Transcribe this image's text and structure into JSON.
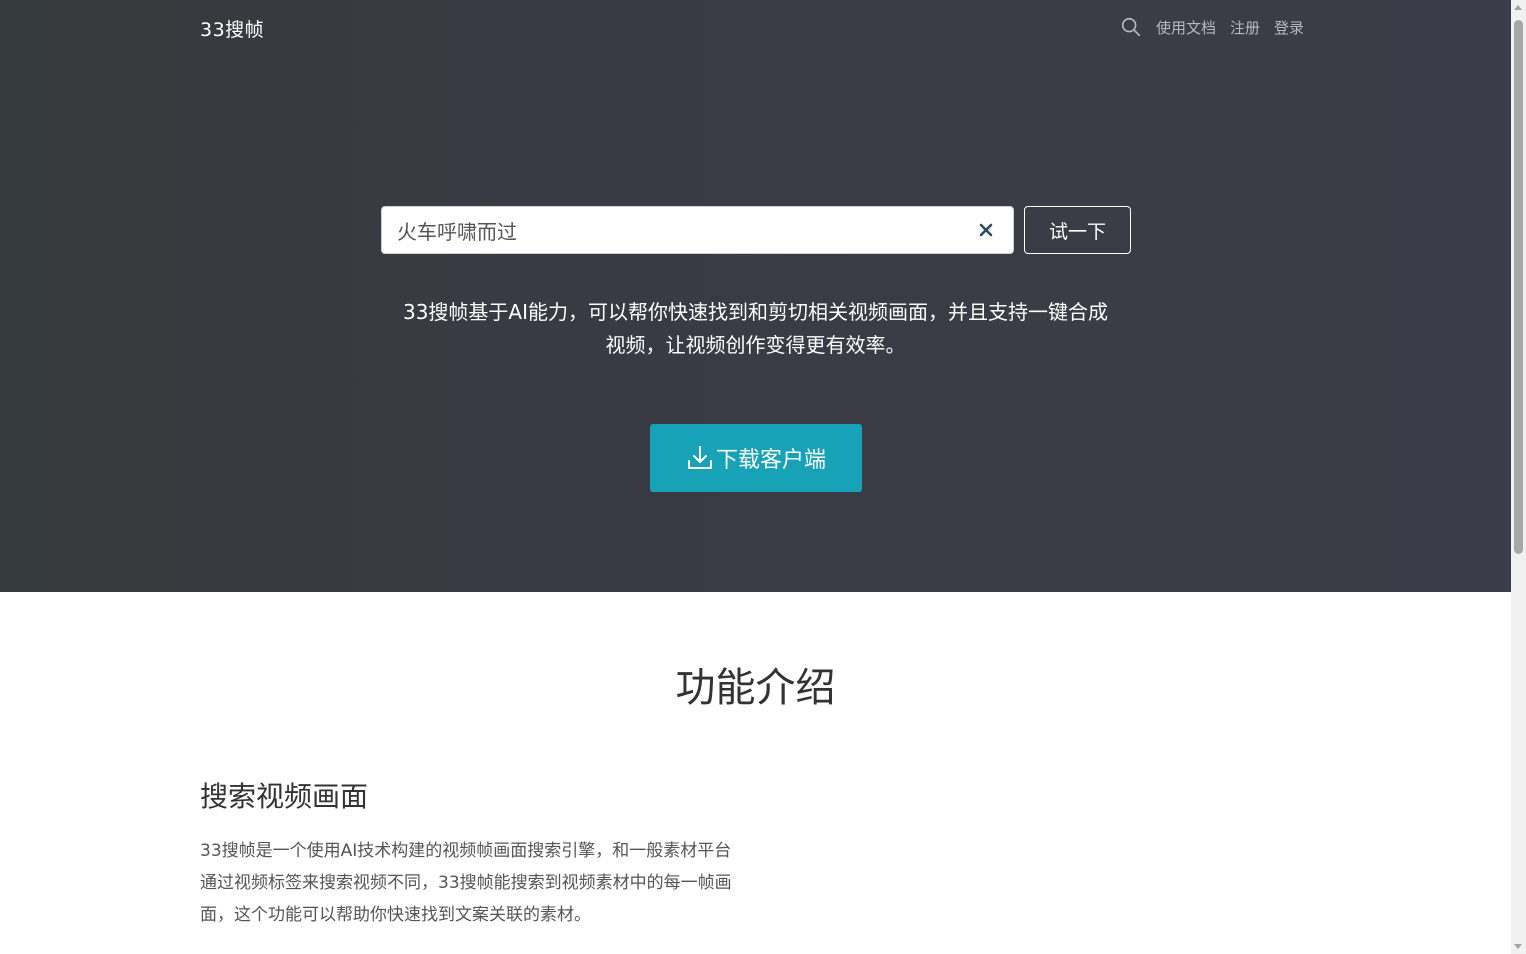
{
  "nav": {
    "brand": "33搜帧",
    "links": [
      "使用文档",
      "注册",
      "登录"
    ],
    "search_icon": "search-icon"
  },
  "hero": {
    "search_value": "火车呼啸而过",
    "clear_icon": "close-icon",
    "try_label": "试一下",
    "description": "33搜帧基于AI能力，可以帮你快速找到和剪切相关视频画面，并且支持一键合成视频，让视频创作变得更有效率。",
    "download_label": "下载客户端",
    "download_icon": "download-icon"
  },
  "features": {
    "title": "功能介绍",
    "items": [
      {
        "heading": "搜索视频画面",
        "text": "33搜帧是一个使用AI技术构建的视频帧画面搜索引擎，和一般素材平台通过视频标签来搜索视频不同，33搜帧能搜索到视频素材中的每一帧画面，这个功能可以帮助你快速找到文案关联的素材。"
      }
    ]
  },
  "colors": {
    "hero_bg": "#3b3c47",
    "accent": "#17a2b8",
    "nav_link": "#b7b9c0"
  }
}
